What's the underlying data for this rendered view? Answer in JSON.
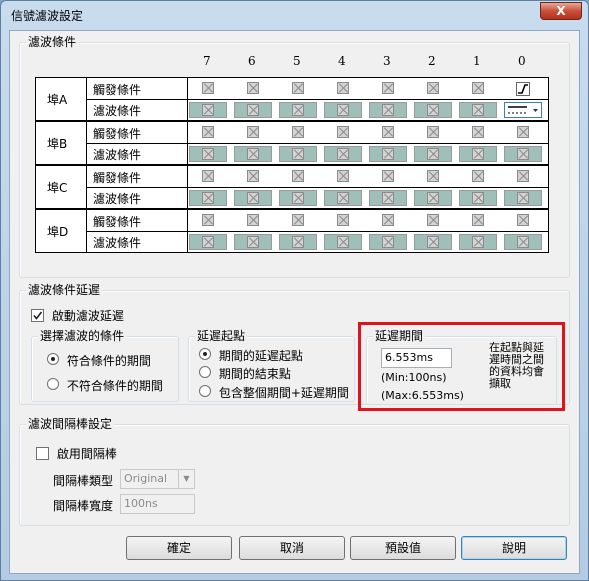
{
  "window": {
    "title": "信號濾波設定",
    "close_glyph": "X"
  },
  "filter_group": {
    "legend": "濾波條件",
    "bit_headers": [
      "7",
      "6",
      "5",
      "4",
      "3",
      "2",
      "1",
      "0"
    ],
    "ports": [
      {
        "name": "埠A",
        "trigger_label": "觸發條件",
        "filter_label": "濾波條件"
      },
      {
        "name": "埠B",
        "trigger_label": "觸發條件",
        "filter_label": "濾波條件"
      },
      {
        "name": "埠C",
        "trigger_label": "觸發條件",
        "filter_label": "濾波條件"
      },
      {
        "name": "埠D",
        "trigger_label": "觸發條件",
        "filter_label": "濾波條件"
      }
    ],
    "cell_color": "#9fc0b8"
  },
  "delay_group": {
    "legend": "濾波條件延遲",
    "enable_label": "啟動濾波延遲",
    "condition": {
      "legend": "選擇濾波的條件",
      "options": [
        "符合條件的期間",
        "不符合條件的期間"
      ]
    },
    "start": {
      "legend": "延遲起點",
      "options": [
        "期間的延遲起點",
        "期間的結束點",
        "包含整個期間+延遲期間"
      ]
    },
    "period": {
      "legend": "延遲期間",
      "value": "6.553ms",
      "min_text": "(Min:100ns)",
      "max_text": "(Max:6.553ms)",
      "description": "在起點與延遲時間之間的資料均會擷取",
      "highlight_color": "#e0141e"
    }
  },
  "gap_group": {
    "legend": "濾波間隔棒設定",
    "enable_label": "啟用間隔棒",
    "type_label": "間隔棒類型",
    "type_value": "Original",
    "width_label": "間隔棒寬度",
    "width_value": "100ns"
  },
  "buttons": {
    "ok": "確定",
    "cancel": "取消",
    "defaults": "預設值",
    "help": "說明"
  }
}
